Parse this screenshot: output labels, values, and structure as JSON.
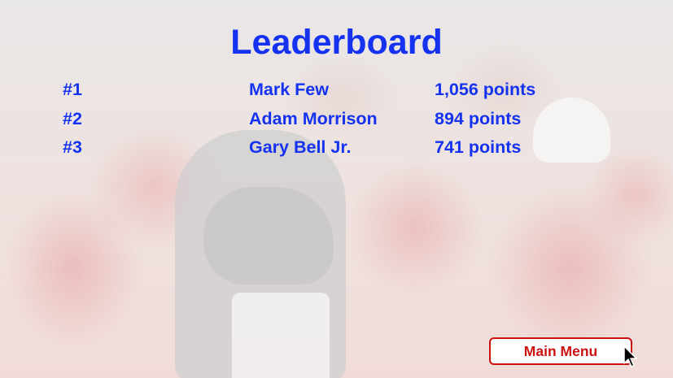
{
  "title": "Leaderboard",
  "leaderboard": [
    {
      "rank": "#1",
      "name": "Mark Few",
      "points": "1,056 points"
    },
    {
      "rank": "#2",
      "name": "Adam Morrison",
      "points": "894 points"
    },
    {
      "rank": "#3",
      "name": "Gary Bell Jr.",
      "points": "741 points"
    }
  ],
  "main_menu_label": "Main Menu",
  "colors": {
    "title": "#1432f0",
    "button": "#cc1111"
  },
  "icons": {
    "cursor": "mouse-pointer-icon"
  }
}
